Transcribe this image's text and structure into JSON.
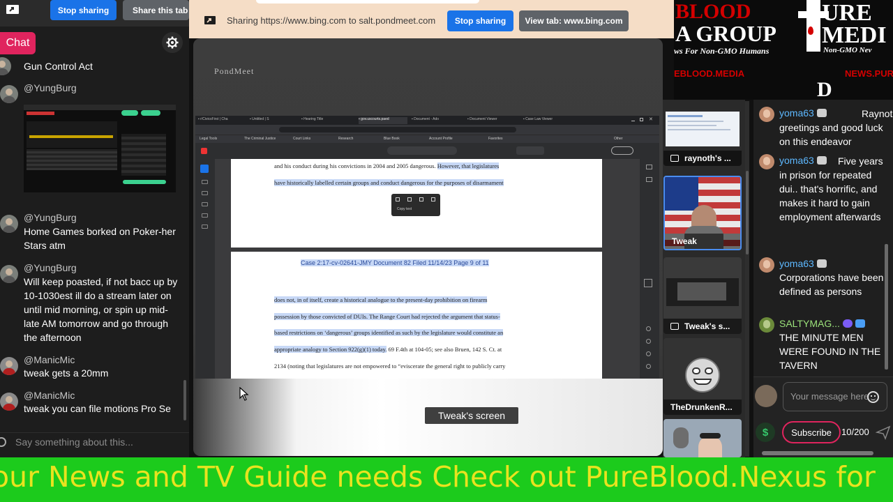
{
  "left_panel": {
    "stop_sharing_label": "Stop sharing",
    "share_tab_label": "Share this tab i",
    "chat_tab_label": "Chat",
    "messages": [
      {
        "user": "",
        "text": "Gun Control Act"
      },
      {
        "user": "@YungBurg",
        "text": ""
      },
      {
        "user": "@YungBurg",
        "text": "Home Games borked on Poker-her Stars atm"
      },
      {
        "user": "@YungBurg",
        "text": "Will keep poasted, if not bacc up by 10-1030est ill do a stream later on until mid morning, or spin up mid-late AM tomorrow and go through the afternoon"
      },
      {
        "user": "@ManicMic",
        "text": "tweak gets a 20mm"
      },
      {
        "user": "@ManicMic",
        "text": "tweak you can file motions Pro Se"
      }
    ],
    "say_placeholder": "Say something about this..."
  },
  "share_bar": {
    "text": "Sharing https://www.bing.com to salt.pondmeet.com",
    "stop_sharing_label": "Stop sharing",
    "view_tab_label": "View tab: www.bing.com"
  },
  "stage": {
    "watermark": "PondMeet",
    "screen_label": "Tweak's screen",
    "pdf": {
      "page1_lines": [
        {
          "plain": "and his conduct during his convictions in 2004 and 2005 dangerous.  ",
          "hl": "However, that legislatures"
        },
        {
          "plain": "",
          "hl": "have historically labelled certain groups and conduct dangerous for the purposes of disarmament"
        }
      ],
      "page2_header": "Case 2:17-cv-02641-JMY   Document 82   Filed 11/14/23   Page 9 of 11",
      "page2_lines": [
        {
          "hl": "does not, in of itself, create a historical analogue to the present-day prohibition on firearm",
          "plain": ""
        },
        {
          "hl": "possession by those convicted of DUIs.  The Range Court had rejected the argument that status-",
          "plain": ""
        },
        {
          "hl": "based restrictions on ‘dangerous’ groups identified as such by the legislature would constitute an",
          "plain": ""
        },
        {
          "hl": "appropriate analogy to Section 922(g)(1) today.",
          "plain": "  69 F.4th at 104-05; see also Bruen, 142 S. Ct. at"
        },
        {
          "hl": "",
          "plain": "2134 (noting that legislatures are not empowered to “eviscerate the general right to publicly carry"
        }
      ],
      "popup_label": "Copy text"
    }
  },
  "tiles": [
    {
      "label": "raynoth's ...",
      "sharing": true
    },
    {
      "label": "Tweak",
      "sharing": false
    },
    {
      "label": "Tweak's s...",
      "sharing": true
    },
    {
      "label": "TheDrunkenR...",
      "sharing": false
    },
    {
      "label": "",
      "sharing": false
    }
  ],
  "banner": {
    "line1": "BLOOD",
    "line2": "A GROUP",
    "line3": "ws For Non-GMO Humans",
    "line4": "EBLOOD.MEDIA",
    "right1": "URE",
    "right2": "MEDI",
    "right3": "Non-GMO Nev",
    "right4": "NEWS.PURI"
  },
  "right_chat": {
    "messages": [
      {
        "user": "yoma63",
        "text": "Raynoth greetings and good luck on this endeavor",
        "color": "#5db8ff"
      },
      {
        "user": "yoma63",
        "text": "Five years in prison for repeated dui.. that's horrific, and makes it hard to gain employment afterwards",
        "color": "#5db8ff"
      },
      {
        "user": "yoma63",
        "text": "Corporations have been defined as persons",
        "color": "#5db8ff"
      },
      {
        "user": "SALTYMAG...",
        "text": "THE MINUTE MEN WERE FOUND IN THE TAVERN",
        "color": "#9be27a"
      }
    ],
    "input_placeholder": "Your message here",
    "subscribe_label": "Subscribe",
    "char_count": "10/200"
  },
  "ticker": {
    "text": "our News and TV Guide needs Check out PureBlood.Nexus for"
  },
  "colors": {
    "accent_blue": "#1a73e8",
    "chat_tab": "#e0245e",
    "ticker_bg": "#1ccb1c",
    "ticker_text": "#e9e31f"
  }
}
